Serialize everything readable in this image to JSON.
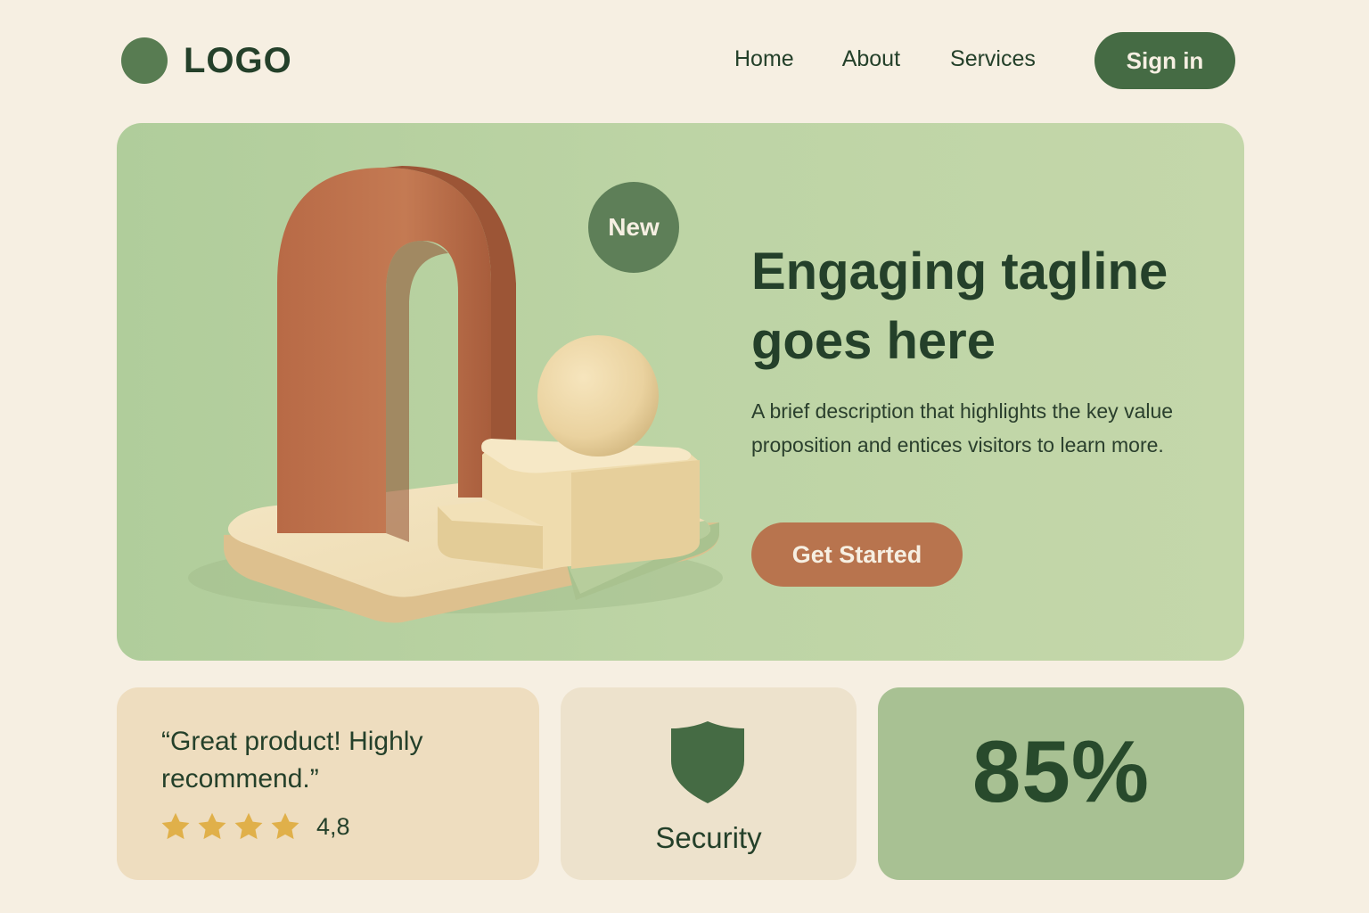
{
  "header": {
    "logo_text": "LOGO",
    "nav": {
      "home": "Home",
      "about": "About",
      "services": "Services"
    },
    "signin_label": "Sign in"
  },
  "hero": {
    "badge": "New",
    "title": "Engaging tagline goes here",
    "description": "A brief description that highlights the key value proposition and entices visitors to learn more.",
    "cta_label": "Get Started"
  },
  "cards": {
    "review": {
      "quote": "“Great product! Highly recommend.”",
      "stars": 4,
      "rating": "4,8"
    },
    "security": {
      "icon": "shield-icon",
      "label": "Security"
    },
    "stat": {
      "value": "85%"
    }
  },
  "colors": {
    "background": "#f6efe2",
    "primary_green": "#456b44",
    "hero_green": "#bdd4a5",
    "accent_terracotta": "#b8744e",
    "star_gold": "#e0b04a",
    "text_dark": "#24402a"
  }
}
